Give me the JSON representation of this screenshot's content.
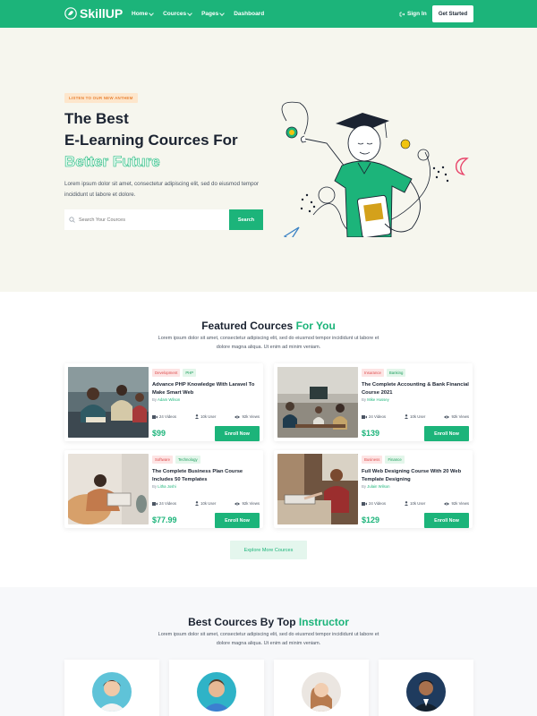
{
  "nav": {
    "brand": "SkillUP",
    "menu": [
      {
        "label": "Home",
        "has_dropdown": true
      },
      {
        "label": "Cources",
        "has_dropdown": true
      },
      {
        "label": "Pages",
        "has_dropdown": true
      },
      {
        "label": "Dashboard",
        "has_dropdown": false
      }
    ],
    "signin": "Sign In",
    "cta": "Get Started"
  },
  "hero": {
    "tagline": "LISTEN TO OUR NEW ANTHEM",
    "title_line1": "The Best",
    "title_line2": "E-Learning Cources For",
    "title_outline": "Better Future",
    "description": "Lorem ipsum dolor sit amet, consectetur adipiscing elit, sed do eiusmod tempor incididunt ut labore et dolore.",
    "search_placeholder": "Search Your Cources",
    "search_button": "Search"
  },
  "featured": {
    "title": "Featured Cources",
    "title_accent": "For You",
    "subtitle": "Lorem ipsum dolor sit amet, consectetur adipiscing elit, sed do eiusmod tempor incididunt ut labore et dolore magna aliqua. Ut enim ad minim veniam.",
    "courses": [
      {
        "tags": [
          "Development",
          "PHP"
        ],
        "title": "Advance PHP Knowledge With Laravel To Make Smart Web",
        "by": "By",
        "author": "Adam Wilson",
        "videos": "24 Videos",
        "users": "10k User",
        "views": "92k Views",
        "price": "$99",
        "enroll": "Enroll Now"
      },
      {
        "tags": [
          "Insurance",
          "Banking"
        ],
        "title": "The Complete Accounting & Bank Financial Course 2021",
        "by": "By",
        "author": "Mike Hussey",
        "videos": "24 Videos",
        "users": "10k User",
        "views": "92k Views",
        "price": "$139",
        "enroll": "Enroll Now"
      },
      {
        "tags": [
          "Software",
          "Technology"
        ],
        "title": "The Complete Business Plan Course Includes 50 Templates",
        "by": "By",
        "author": "Litha Joshi",
        "videos": "24 Videos",
        "users": "10k User",
        "views": "92k Views",
        "price": "$77.99",
        "enroll": "Enroll Now"
      },
      {
        "tags": [
          "Business",
          "Finance"
        ],
        "title": "Full Web Designing Course With 20 Web Template Designing",
        "by": "By",
        "author": "Julain Wilson",
        "videos": "24 Videos",
        "users": "10k User",
        "views": "92k Views",
        "price": "$129",
        "enroll": "Enroll Now"
      }
    ],
    "explore": "Explore More Cources"
  },
  "instructors": {
    "title": "Best Cources By Top",
    "title_accent": "Instructor",
    "subtitle": "Lorem ipsum dolor sit amet, consectetur adipiscing elit, sed do eiusmod tempor incididunt ut labore et dolore magna aliqua. Ut enim ad minim veniam."
  },
  "colors": {
    "brand": "#1cb47a",
    "hero_bg": "#f6f6ee",
    "tag_red": "#dd4b4b",
    "tag_green": "#1e9e5e"
  }
}
